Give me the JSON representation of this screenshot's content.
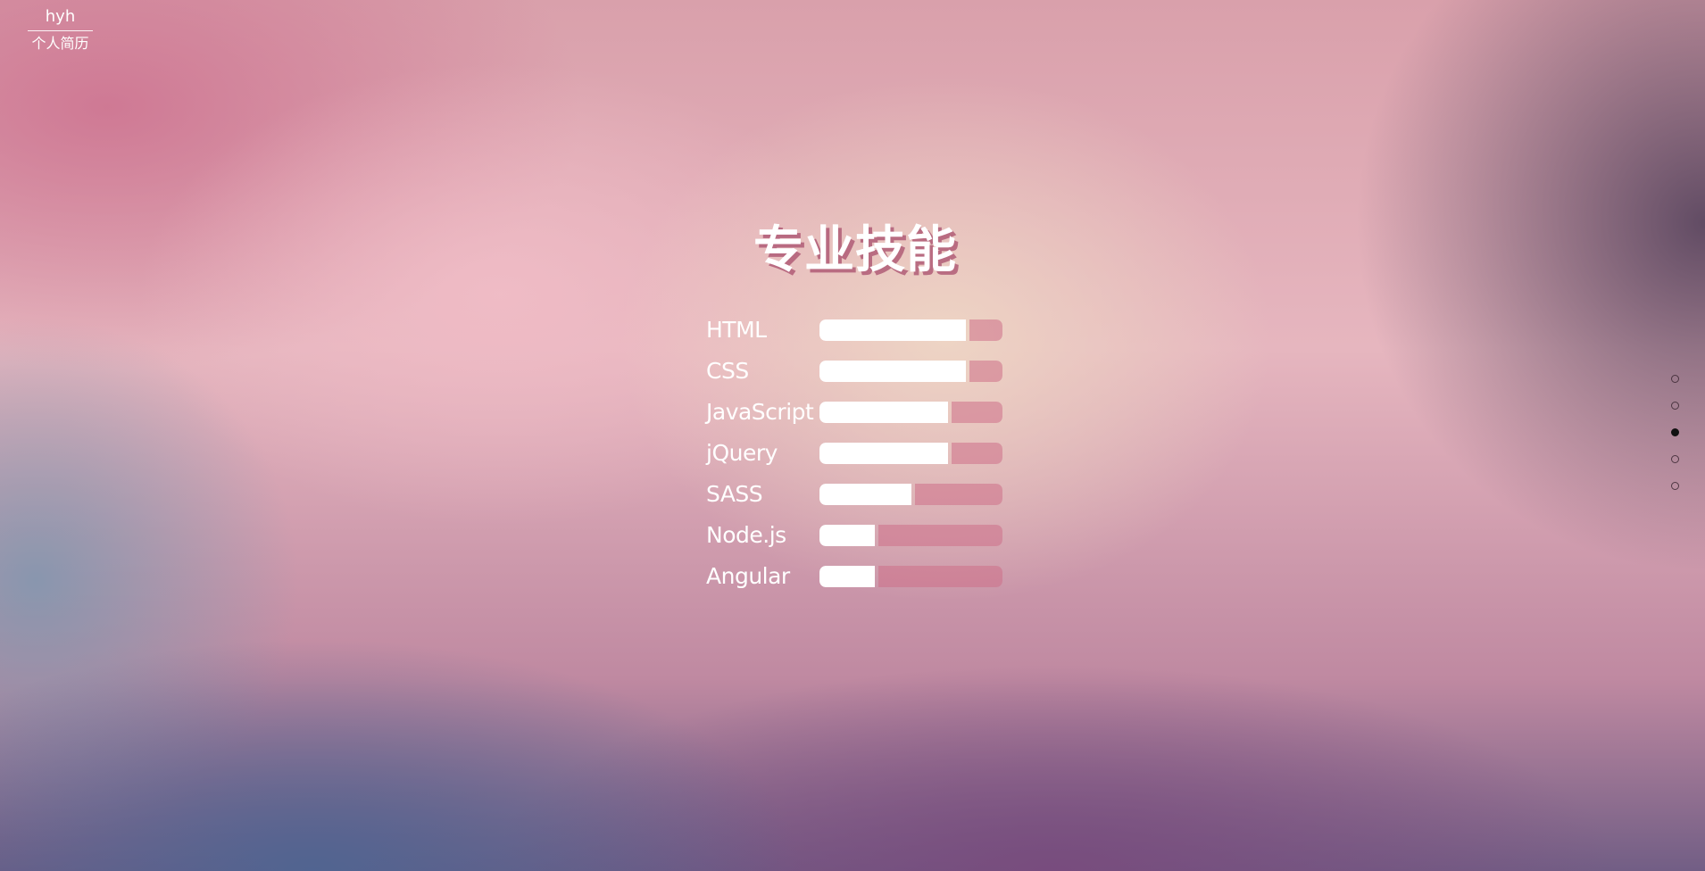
{
  "logo": {
    "name": "hyh",
    "subtitle": "个人简历"
  },
  "section": {
    "title": "专业技能"
  },
  "skills": [
    {
      "name": "HTML",
      "level": 0.8
    },
    {
      "name": "CSS",
      "level": 0.8
    },
    {
      "name": "JavaScript",
      "level": 0.7
    },
    {
      "name": "jQuery",
      "level": 0.7
    },
    {
      "name": "SASS",
      "level": 0.5
    },
    {
      "name": "Node.js",
      "level": 0.3
    },
    {
      "name": "Angular",
      "level": 0.3
    }
  ],
  "page_dots": {
    "count": 5,
    "active_index": 2
  },
  "colors": {
    "bar_fill": "#ffffff",
    "bar_track": "#cf7088",
    "title_shadow": "#a84e6c"
  }
}
